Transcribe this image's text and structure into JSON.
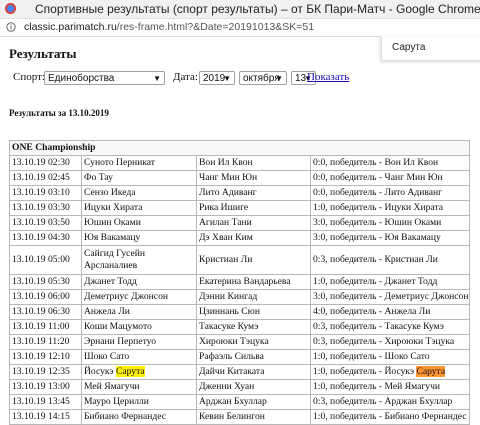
{
  "browser": {
    "window_title": "Спортивные результаты (спорт результаты) – от БК Пари-Матч - Google Chrome",
    "url_host": "classic.parimatch.ru",
    "url_path": "/res-frame.html?&Date=20191013&SK=51"
  },
  "find_bar": {
    "query": "Сарута"
  },
  "page": {
    "heading": "Результаты",
    "sport_label": "Спорт:",
    "sport_value": "Единоборства",
    "date_label": "Дата:",
    "year_value": "2019",
    "month_value": "октября",
    "day_value": "13",
    "show_link": "Показать",
    "results_date": "Результаты за 13.10.2019"
  },
  "table": {
    "caption": "ONE Championship",
    "rows": [
      {
        "time": "13.10.19 02:30",
        "p1": "Суното Перникат",
        "p2": "Вон Ил Квон",
        "result": "0:0, победитель - Вон Ил Квон"
      },
      {
        "time": "13.10.19 02:45",
        "p1": "Фо Тау",
        "p2": "Чанг Мин Юн",
        "result": "0:0, победитель - Чанг Мин Юн"
      },
      {
        "time": "13.10.19 03:10",
        "p1": "Сензо Икеда",
        "p2": "Лито Адиванг",
        "result": "0:0, победитель - Лито Адиванг"
      },
      {
        "time": "13.10.19 03:30",
        "p1": "Ицуки Хирата",
        "p2": "Рика Ишиге",
        "result": "1:0, победитель - Ицуки Хирата"
      },
      {
        "time": "13.10.19 03:50",
        "p1": "Юшин Оками",
        "p2": "Агилан Тани",
        "result": "3:0, победитель - Юшин Оками"
      },
      {
        "time": "13.10.19 04:30",
        "p1": "Юя Вакамацу",
        "p2": "Дэ Хван Ким",
        "result": "3:0, победитель - Юя Вакамацу"
      },
      {
        "time": "13.10.19 05:00",
        "p1": "Сайгид Гусейн Арсланалиев",
        "p2": "Кристиан Ли",
        "result": "0:3, победитель - Кристиан Ли",
        "tall": true
      },
      {
        "time": "13.10.19 05:30",
        "p1": "Джанет Тодд",
        "p2": "Екатерина Вандарьева",
        "result": "1:0, победитель - Джанет Тодд"
      },
      {
        "time": "13.10.19 06:00",
        "p1": "Деметриус Джонсон",
        "p2": "Дэнни Кингад",
        "result": "3:0, победитель - Деметриус Джонсон"
      },
      {
        "time": "13.10.19 06:30",
        "p1": "Анжела Ли",
        "p2": "Цзиннань Сюн",
        "result": "4:0, победитель - Анжела Ли"
      },
      {
        "time": "13.10.19 11:00",
        "p1": "Коши Мацумото",
        "p2": "Такасуке Кумэ",
        "result": "0:3, победитель - Такасуке Кумэ"
      },
      {
        "time": "13.10.19 11:20",
        "p1": "Эрнани Перпетуо",
        "p2": "Хироюки Тэцука",
        "result": "0:3, победитель - Хироюки Тэцука"
      },
      {
        "time": "13.10.19 12:10",
        "p1": "Шоко Сато",
        "p2": "Рафаэль Сильва",
        "result": "1:0, победитель - Шоко Сато"
      },
      {
        "time": "13.10.19 12:35",
        "p1": "Йосукэ ",
        "p1_hl": "Сарута",
        "p2": "Дайчи Китаката",
        "result": "1:0, победитель - Йосукэ ",
        "result_hl": "Сарута"
      },
      {
        "time": "13.10.19 13:00",
        "p1": "Мей Ямагучи",
        "p2": "Дженни Хуан",
        "result": "1:0, победитель - Мей Ямагучи"
      },
      {
        "time": "13.10.19 13:45",
        "p1": "Мауро Церилли",
        "p2": "Арджан Бхуллар",
        "result": "0:3, победитель - Арджан Бхуллар"
      },
      {
        "time": "13.10.19 14:15",
        "p1": "Бибиано Фернандес",
        "p2": "Кевин Белингон",
        "result": "1:0, победитель - Бибиано Фернандес"
      }
    ]
  },
  "colors": {
    "link": "#1a0dab",
    "find_current": "#ff9632",
    "find_match": "#fff200"
  }
}
